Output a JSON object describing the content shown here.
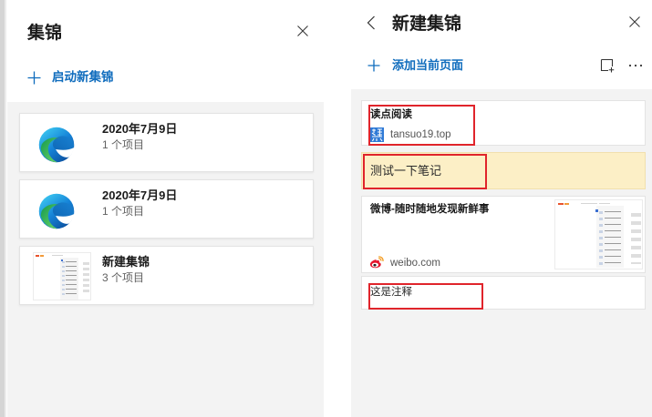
{
  "left_panel": {
    "title": "集锦",
    "close_icon": "close-icon",
    "new_collection": {
      "icon": "plus-icon",
      "label": "启动新集锦"
    },
    "collections": [
      {
        "title": "2020年7月9日",
        "count": "1 个项目",
        "thumbnail_icon": "edge-logo-icon"
      },
      {
        "title": "2020年7月9日",
        "count": "1 个项目",
        "thumbnail_icon": "edge-logo-icon"
      },
      {
        "title": "新建集锦",
        "count": "3 个项目",
        "thumbnail_icon": "page-screenshot-thumbnail"
      }
    ]
  },
  "right_panel": {
    "title": "新建集锦",
    "back_icon": "chevron-left-icon",
    "close_icon": "close-icon",
    "add_current_page": {
      "icon": "plus-icon",
      "label": "添加当前页面"
    },
    "toolbar_icons": [
      "add-note-icon",
      "more-icon"
    ],
    "items": [
      {
        "title": "读点阅读",
        "site": "tansuo19.top",
        "icon": "tansuo-favicon-icon"
      },
      {
        "note": "测试一下笔记"
      },
      {
        "title": "微博-随时随地发现新鲜事",
        "site": "weibo.com",
        "icon": "weibo-icon",
        "thumbnail_icon": "page-screenshot-thumbnail"
      },
      {
        "note": "这是注释"
      }
    ]
  },
  "colors": {
    "accent": "#0f6cbd",
    "panel_background": "#f3f3f3",
    "note_background": "#fcefc6",
    "annotation": "#e0242b"
  }
}
